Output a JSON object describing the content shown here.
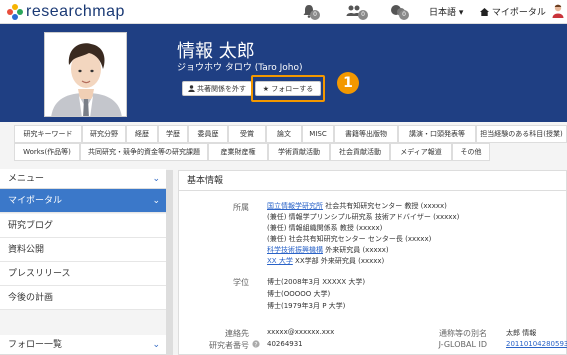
{
  "topbar": {
    "logo_text": "researchmap",
    "badges": [
      "0",
      "0",
      "0"
    ],
    "language": "日本語 ▾",
    "portal": "マイポータル"
  },
  "profile": {
    "name": "情報 太郎",
    "kana": "ジョウホウ タロウ (Taro Joho)",
    "unshare_button": "共著関係を外す",
    "follow_button": "★ フォローする",
    "callout": "1"
  },
  "tabs_row1": [
    "研究キーワード",
    "研究分野",
    "経歴",
    "学歴",
    "委員歴",
    "受賞",
    "論文",
    "MISC",
    "書籍等出版物",
    "講演・口頭発表等",
    "担当経験のある科目(授業)"
  ],
  "tabs_row2": [
    "Works(作品等)",
    "共同研究・競争的資金等の研究課題",
    "産業財産権",
    "学術貢献活動",
    "社会貢献活動",
    "メディア報道",
    "その他"
  ],
  "sidebar": {
    "menu_header": "メニュー",
    "items": [
      "マイポータル",
      "研究ブログ",
      "資料公開",
      "プレスリリース",
      "今後の計画"
    ],
    "follow_header": "フォロー一覧"
  },
  "main": {
    "title": "基本情報",
    "affiliation_label": "所属",
    "affiliation": [
      {
        "link": "国立情報学研究所",
        "text": " 社会共有知研究センター 教授 (xxxxx)"
      },
      {
        "link": "",
        "text": "(兼任) 情報学プリンシプル研究系 技術アドバイザー (xxxxx)"
      },
      {
        "link": "",
        "text": "(兼任) 情報組織関係系 教授 (xxxxx)"
      },
      {
        "link": "",
        "text": "(兼任) 社会共有知研究センター センター長 (xxxxx)"
      },
      {
        "link": "科学技術振興機構",
        "text": " 外来研究員 (xxxxx)"
      },
      {
        "link": "XX 大学",
        "text": " XX学部 外来研究員 (xxxxx)"
      }
    ],
    "degree_label": "学位",
    "degrees": [
      "博士(2008年3月 XXXXX 大学)",
      "博士(OOOOO 大学)",
      "博士(1979年3月 P 大学)"
    ],
    "contact_label": "連絡先",
    "contact_value": "xxxxx@xxxxxx.xxx",
    "researcher_no_label": "研究者番号",
    "researcher_no": "40264931",
    "alias_label": "通称等の別名",
    "alias_value": "太郎 情報",
    "jglobal_label": "J-GLOBAL ID",
    "jglobal_value": "201101042805931"
  }
}
